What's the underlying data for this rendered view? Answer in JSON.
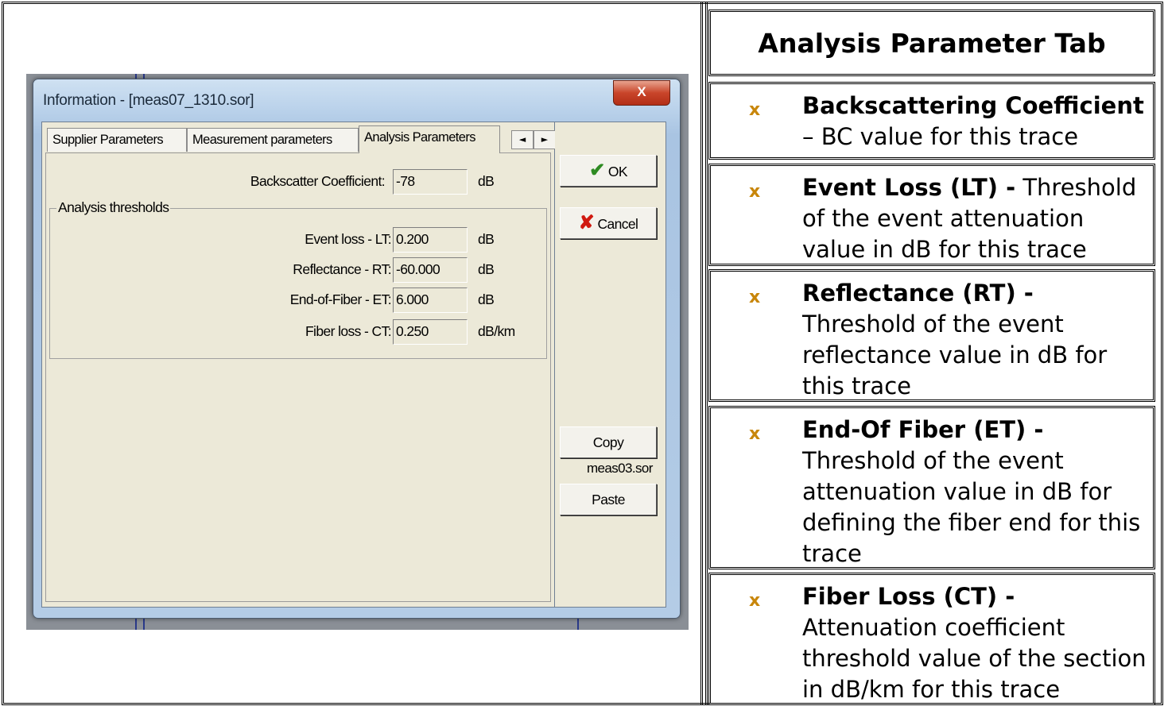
{
  "heading": "Analysis Parameter Tab",
  "items": [
    {
      "title": "Backscattering Coefficient",
      "sep": " – ",
      "desc": "BC value for this trace"
    },
    {
      "title": "Event Loss (LT) -",
      "sep": " ",
      "desc": "Threshold of the event attenuation value in dB for this trace"
    },
    {
      "title": "Reflectance (RT) -",
      "sep": " ",
      "desc": "Threshold of the event reflectance value in dB for this trace"
    },
    {
      "title": "End-Of Fiber (ET) -",
      "sep": " ",
      "desc": "Threshold of the event attenuation value in dB for defining the fiber end for this trace"
    },
    {
      "title": "Fiber Loss (CT) -",
      "sep": " ",
      "desc": "Attenuation coefficient threshold value of the section in dB/km for this trace"
    }
  ],
  "bullet_glyph": "x",
  "dialog": {
    "title": "Information - [meas07_1310.sor]",
    "close": "X",
    "tabs": [
      "Supplier Parameters",
      "Measurement parameters",
      "Analysis Parameters"
    ],
    "active_tab": "Analysis Parameters",
    "arrows": [
      "◄",
      "►"
    ],
    "backscatter": {
      "label": "Backscatter Coefficient:",
      "value": "-78",
      "unit": "dB"
    },
    "group_label": "Analysis thresholds",
    "fields": [
      {
        "label": "Event loss - LT:",
        "value": "0.200",
        "unit": "dB"
      },
      {
        "label": "Reflectance - RT:",
        "value": "-60.000",
        "unit": "dB"
      },
      {
        "label": "End-of-Fiber - ET:",
        "value": "6.000",
        "unit": "dB"
      },
      {
        "label": "Fiber loss - CT:",
        "value": "0.250",
        "unit": "dB/km"
      }
    ],
    "buttons": {
      "ok": "OK",
      "cancel": "Cancel",
      "copy": "Copy",
      "paste": "Paste"
    },
    "source_file": "meas03.sor"
  },
  "colors": {
    "bullet": "#c8860a",
    "ok_check": "#2e8b22",
    "cancel_x": "#d0190f"
  }
}
